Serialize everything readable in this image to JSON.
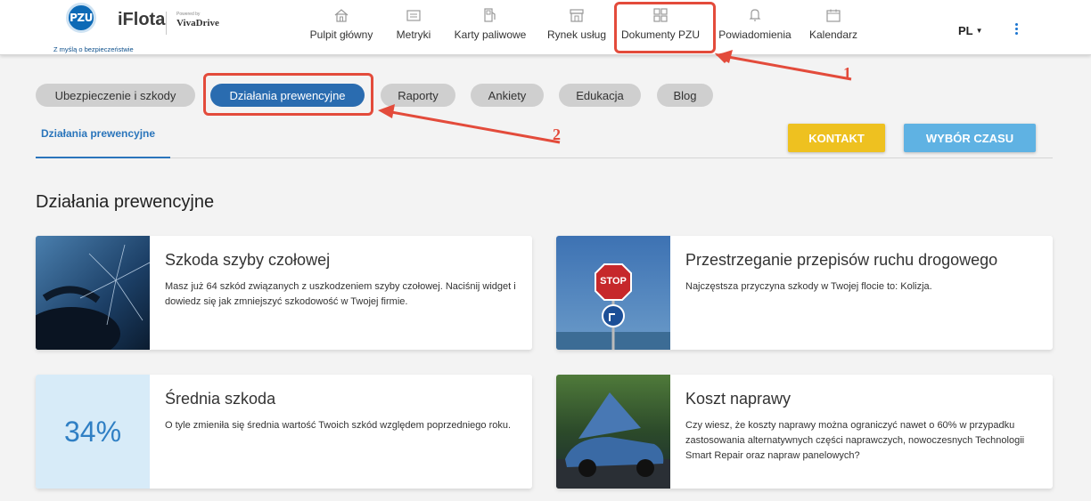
{
  "header": {
    "logo_text": "PZU",
    "logo_tagline": "Z myślą o bezpieczeństwie",
    "app_name": "iFlota",
    "powered_by": "Powered by",
    "partner_name": "VivaDrive",
    "nav": [
      {
        "label": "Pulpit główny",
        "icon": "home-icon"
      },
      {
        "label": "Metryki",
        "icon": "metrics-icon"
      },
      {
        "label": "Karty paliwowe",
        "icon": "fuel-pump-icon"
      },
      {
        "label": "Rynek usług",
        "icon": "store-icon"
      },
      {
        "label": "Dokumenty PZU",
        "icon": "documents-grid-icon"
      },
      {
        "label": "Powiadomienia",
        "icon": "bell-icon"
      },
      {
        "label": "Kalendarz",
        "icon": "calendar-icon"
      }
    ],
    "language": "PL"
  },
  "pills": [
    {
      "label": "Ubezpieczenie i szkody",
      "active": false
    },
    {
      "label": "Działania prewencyjne",
      "active": true
    },
    {
      "label": "Raporty",
      "active": false
    },
    {
      "label": "Ankiety",
      "active": false
    },
    {
      "label": "Edukacja",
      "active": false
    },
    {
      "label": "Blog",
      "active": false
    }
  ],
  "subtab": {
    "label": "Działania prewencyjne"
  },
  "buttons": {
    "contact": "KONTAKT",
    "time": "WYBÓR CZASU"
  },
  "section_title": "Działania prewencyjne",
  "cards": [
    {
      "title": "Szkoda szyby czołowej",
      "description": "Masz już 64 szkód związanych z uszkodzeniem szyby czołowej. Naciśnij widget i dowiedz się jak zmniejszyć szkodowość w Twojej firmie."
    },
    {
      "title": "Przestrzeganie przepisów ruchu drogowego",
      "description": "Najczęstsza przyczyna szkody w Twojej flocie to: Kolizja."
    },
    {
      "title": "Średnia szkoda",
      "stat": "34%",
      "description": "O tyle zmieniła się średnia wartość Twoich szkód względem poprzedniego roku."
    },
    {
      "title": "Koszt naprawy",
      "description": "Czy wiesz, że koszty naprawy można ograniczyć nawet o 60% w przypadku zastosowania alternatywnych części naprawczych, nowoczesnych Technologii Smart Repair oraz napraw panelowych?"
    }
  ],
  "stop_sign_text": "STOP",
  "annotations": {
    "one": "1",
    "two": "2"
  },
  "colors": {
    "accent": "#2a6cb0",
    "annotation": "#e34b3b",
    "contact": "#eec120",
    "time": "#5fb2e3"
  }
}
